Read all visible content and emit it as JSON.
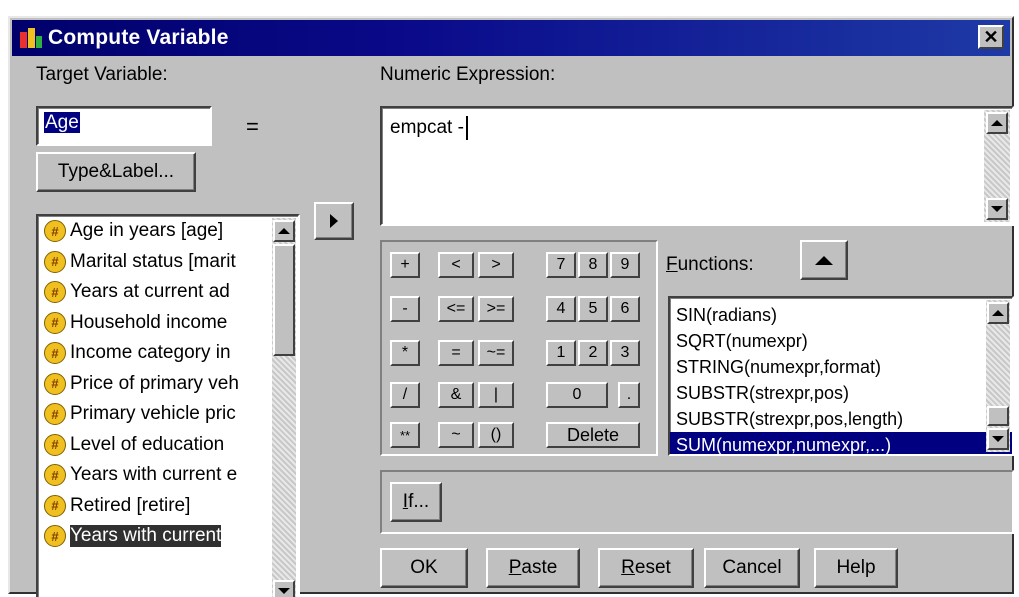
{
  "window": {
    "title": "Compute Variable",
    "close_glyph": "✕"
  },
  "target": {
    "label": "Target Variable:",
    "value": "Age",
    "equals": "=",
    "type_label_button": "Type&Label..."
  },
  "expression": {
    "label": "Numeric Expression:",
    "value": "empcat -"
  },
  "move_button_icon": "arrow-right-icon",
  "variables": [
    {
      "label": "Age in years [age]",
      "icon": "numeric-variable-icon"
    },
    {
      "label": "Marital status [marit",
      "icon": "numeric-variable-icon"
    },
    {
      "label": "Years at current ad",
      "icon": "numeric-variable-icon"
    },
    {
      "label": "Household income",
      "icon": "numeric-variable-icon"
    },
    {
      "label": "Income category in",
      "icon": "numeric-variable-icon"
    },
    {
      "label": "Price of primary veh",
      "icon": "numeric-variable-icon"
    },
    {
      "label": "Primary vehicle pric",
      "icon": "numeric-variable-icon"
    },
    {
      "label": "Level of education",
      "icon": "numeric-variable-icon"
    },
    {
      "label": "Years with current e",
      "icon": "numeric-variable-icon"
    },
    {
      "label": "Retired [retire]",
      "icon": "numeric-variable-icon"
    },
    {
      "label": "Years with current",
      "icon": "numeric-variable-icon",
      "selected": true
    }
  ],
  "keypad": {
    "plus": "+",
    "lt": "<",
    "gt": ">",
    "k7": "7",
    "k8": "8",
    "k9": "9",
    "minus": "-",
    "le": "<=",
    "ge": ">=",
    "k4": "4",
    "k5": "5",
    "k6": "6",
    "mult": "*",
    "eq": "=",
    "ne": "~=",
    "k1": "1",
    "k2": "2",
    "k3": "3",
    "div": "/",
    "and": "&",
    "or": "|",
    "k0": "0",
    "dot": ".",
    "pow": "**",
    "not": "~",
    "parens": "()",
    "delete": "Delete"
  },
  "functions": {
    "label": "Functions:",
    "items": [
      "SIN(radians)",
      "SQRT(numexpr)",
      "STRING(numexpr,format)",
      "SUBSTR(strexpr,pos)",
      "SUBSTR(strexpr,pos,length)",
      "SUM(numexpr,numexpr,...)"
    ],
    "selected_index": 5
  },
  "if_button": "If...",
  "buttons": {
    "ok": "OK",
    "paste": "Paste",
    "reset": "Reset",
    "cancel": "Cancel",
    "help": "Help"
  },
  "colors": {
    "title_bar": "#000080",
    "dialog_bg": "#c0c0c0",
    "selection": "#000080"
  }
}
